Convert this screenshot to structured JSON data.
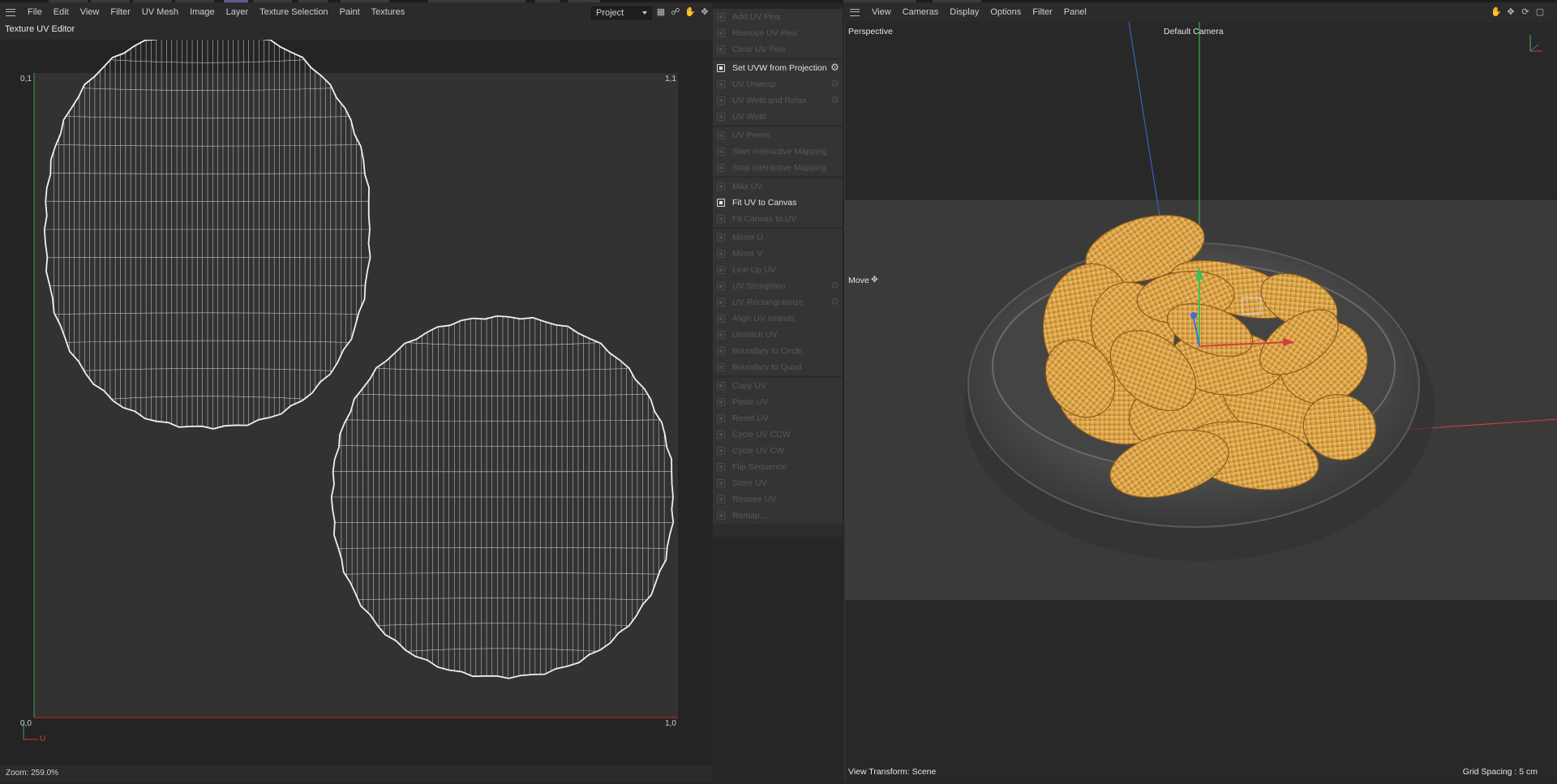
{
  "uv_editor": {
    "menu": [
      "File",
      "Edit",
      "View",
      "Filter",
      "UV Mesh",
      "Image",
      "Layer",
      "Texture Selection",
      "Paint",
      "Textures"
    ],
    "mode_select": "Project",
    "title": "Texture UV Editor",
    "corners": {
      "top_left": "0,1",
      "top_right": "1,1",
      "bottom_left": "0,0",
      "bottom_right": "1,0"
    },
    "axis_u_label": "U",
    "zoom_status": "Zoom: 259.0%",
    "colors": {
      "u_axis": "#c0392b",
      "v_axis": "#3fa34d",
      "wire": "#e8e8e8"
    }
  },
  "commands": {
    "groups": [
      [
        {
          "label": "Add UV Pins",
          "enabled": false
        },
        {
          "label": "Remove UV Pins",
          "enabled": false
        },
        {
          "label": "Clear UV Pins",
          "enabled": false
        }
      ],
      [
        {
          "label": "Set UVW from Projection",
          "enabled": true,
          "gear": true
        },
        {
          "label": "UV Unwrap",
          "enabled": false,
          "gear": true
        },
        {
          "label": "UV Weld and Relax",
          "enabled": false,
          "gear": true
        },
        {
          "label": "UV Weld",
          "enabled": false
        }
      ],
      [
        {
          "label": "UV Peeler",
          "enabled": false
        },
        {
          "label": "Start Interactive Mapping",
          "enabled": false
        },
        {
          "label": "Stop Interactive Mapping",
          "enabled": false
        }
      ],
      [
        {
          "label": "Max UV",
          "enabled": false
        },
        {
          "label": "Fit UV to Canvas",
          "enabled": true
        },
        {
          "label": "Fit Canvas to UV",
          "enabled": false
        }
      ],
      [
        {
          "label": "Mirror U",
          "enabled": false
        },
        {
          "label": "Mirror V",
          "enabled": false
        },
        {
          "label": "Line Up UV",
          "enabled": false
        },
        {
          "label": "UV Straighten",
          "enabled": false,
          "gear": true
        },
        {
          "label": "UV Rectangularize",
          "enabled": false,
          "gear": true
        },
        {
          "label": "Align UV Islands",
          "enabled": false
        },
        {
          "label": "Unstitch UV",
          "enabled": false
        },
        {
          "label": "Boundary to Circle",
          "enabled": false
        },
        {
          "label": "Boundary to Quad",
          "enabled": false
        }
      ],
      [
        {
          "label": "Copy UV",
          "enabled": false
        },
        {
          "label": "Paste UV",
          "enabled": false
        },
        {
          "label": "Reset UV",
          "enabled": false
        },
        {
          "label": "Cycle UV CCW",
          "enabled": false
        },
        {
          "label": "Cycle UV CW",
          "enabled": false
        },
        {
          "label": "Flip Sequence",
          "enabled": false
        },
        {
          "label": "Store UV",
          "enabled": false
        },
        {
          "label": "Restore UV",
          "enabled": false
        },
        {
          "label": "Remap...",
          "enabled": false
        }
      ]
    ]
  },
  "viewport": {
    "menu": [
      "View",
      "Cameras",
      "Display",
      "Options",
      "Filter",
      "Panel"
    ],
    "projection": "Perspective",
    "camera": "Default Camera",
    "tool": "Move",
    "view_transform": "View Transform: Scene",
    "grid_spacing": "Grid Spacing : 5 cm",
    "colors": {
      "chip": "#e0b35a",
      "chip_shadow": "#9a6a22",
      "bowl": "#4a4a4a",
      "axis_x": "#d04040",
      "axis_y": "#3fc05a",
      "axis_z": "#3b6fd8"
    }
  }
}
